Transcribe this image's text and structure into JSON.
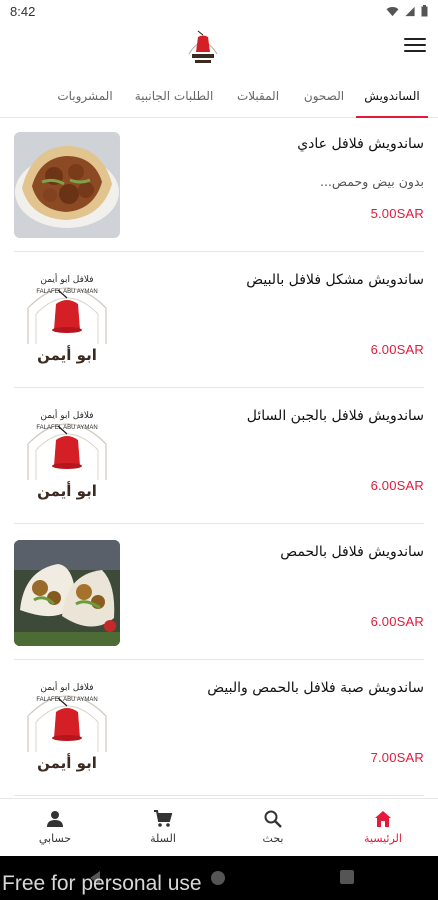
{
  "status_bar": {
    "time": "8:42"
  },
  "header": {
    "logo_icon": "abu-ayman-falafel-logo-icon",
    "menu_icon": "hamburger-menu-icon"
  },
  "tabs": [
    {
      "label": "الساندويش",
      "active": true
    },
    {
      "label": "الصحون",
      "active": false
    },
    {
      "label": "المقبلات",
      "active": false
    },
    {
      "label": "الطلبات الجانبية",
      "active": false
    },
    {
      "label": "المشروبات",
      "active": false
    }
  ],
  "products": [
    {
      "name": "ساندويش فلافل عادي",
      "description": "بدون بيض وحمص...",
      "price": "5.00SAR",
      "image": "falafel-sandwich-photo"
    },
    {
      "name": "ساندويش مشكل فلافل بالبيض",
      "description": "",
      "price": "6.00SAR",
      "image": "logo-image"
    },
    {
      "name": "ساندويش فلافل بالجبن السائل",
      "description": "",
      "price": "6.00SAR",
      "image": "logo-image"
    },
    {
      "name": "ساندويش فلافل بالحمص",
      "description": "",
      "price": "6.00SAR",
      "image": "falafel-wraps-photo"
    },
    {
      "name": "ساندويش صبة فلافل بالحمص والبيض",
      "description": "",
      "price": "7.00SAR",
      "image": "logo-image"
    }
  ],
  "logo_text": {
    "arabic_top": "فلافل ابو أيمن",
    "latin": "FALAFEL ABU AYMAN",
    "arabic_big": "ابو أيمن"
  },
  "bottom_nav": [
    {
      "label": "الرئيسية",
      "icon": "home-icon",
      "active": true
    },
    {
      "label": "بحث",
      "icon": "search-icon",
      "active": false
    },
    {
      "label": "السلة",
      "icon": "cart-icon",
      "active": false
    },
    {
      "label": "حسابي",
      "icon": "person-icon",
      "active": false
    }
  ],
  "watermark": "Free for personal use",
  "colors": {
    "accent": "#e51a3a",
    "fez": "#d41f26",
    "logo_dark": "#3a2a20"
  }
}
